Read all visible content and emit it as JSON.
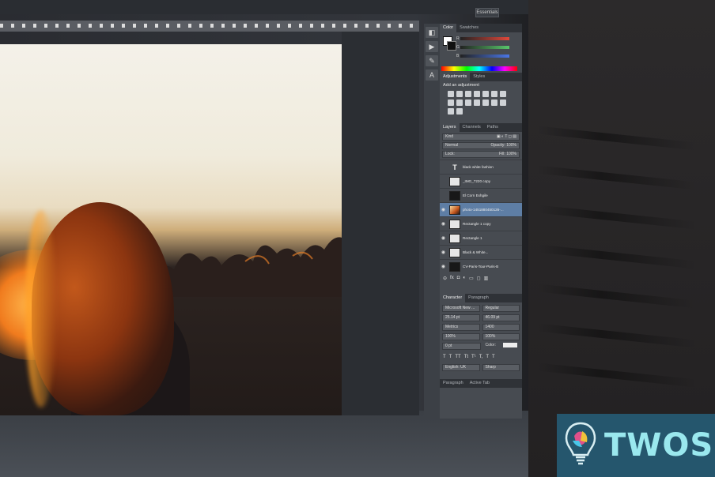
{
  "app": {
    "workspace_label": "Essentials"
  },
  "color_panel": {
    "tabs": [
      "Color",
      "Swatches"
    ],
    "sliders": [
      {
        "label": "R",
        "color": "#e0483b"
      },
      {
        "label": "G",
        "color": "#58c76b"
      },
      {
        "label": "B",
        "color": "#4a76e6"
      }
    ]
  },
  "adjustments_panel": {
    "tabs": [
      "Adjustments",
      "Styles"
    ],
    "heading": "Add an adjustment"
  },
  "layers_panel": {
    "tabs": [
      "Layers",
      "Channels",
      "Paths"
    ],
    "kind_filter": "Kind",
    "blend_mode": "Normal",
    "opacity_label": "Opacity:",
    "opacity_value": "100%",
    "lock_label": "Lock:",
    "fill_label": "Fill:",
    "fill_value": "100%",
    "layers": [
      {
        "name": "black white fashion",
        "thumb": "type",
        "visible": false
      },
      {
        "name": "_IMG_7220 copy",
        "thumb": "plain",
        "visible": false
      },
      {
        "name": "El Corn Exhgile",
        "thumb": "dark",
        "visible": false
      },
      {
        "name": "photo-1451880450126-...",
        "thumb": "photo",
        "visible": true,
        "selected": true
      },
      {
        "name": "Rectangle 1 copy",
        "thumb": "plain",
        "visible": true
      },
      {
        "name": "Rectangle 1",
        "thumb": "plain",
        "visible": true
      },
      {
        "name": "Black & White...",
        "thumb": "plain",
        "visible": true
      },
      {
        "name": "CV-Paris-Tour-Paris-B",
        "thumb": "dark",
        "visible": true
      }
    ]
  },
  "character_panel": {
    "tabs": [
      "Character",
      "Paragraph"
    ],
    "font_family": "Microsoft New ...",
    "font_style": "Regular",
    "font_size": "25.14 pt",
    "leading": "46.09 pt",
    "kerning": "Metrics",
    "tracking": "1400",
    "vertical_scale": "100%",
    "horizontal_scale": "100%",
    "baseline_shift": "0 pt",
    "color_label": "Color:",
    "glyphs_row1": [
      "T",
      "T",
      "TT",
      "Tt",
      "T¹",
      "T,",
      "T",
      "T"
    ],
    "language": "English: UK",
    "antialias": "Sharp"
  },
  "bottom_tabs": [
    "Paragraph",
    "Active Tab"
  ],
  "logo": {
    "text": "TWOS",
    "bg_color": "#25566d",
    "text_color": "#9ae8ee"
  }
}
